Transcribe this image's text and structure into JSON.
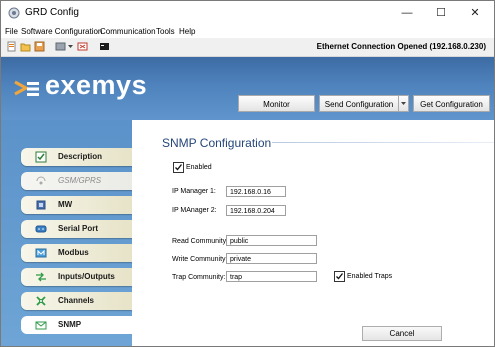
{
  "window": {
    "title": "GRD Config",
    "minimize_glyph": "—",
    "maximize_glyph": "☐",
    "close_glyph": "✕"
  },
  "menubar": {
    "items": [
      "File",
      "Software Configuration",
      "Communication",
      "Tools",
      "Help"
    ]
  },
  "toolbar": {
    "icons": [
      "new-file-icon",
      "open-folder-icon",
      "save-icon",
      "connect-icon",
      "dropdown-icon",
      "disconnect-icon",
      "terminal-icon"
    ],
    "connection_status": "Ethernet Connection Opened (192.168.0.230)"
  },
  "header": {
    "logo_text": "exemys",
    "buttons": {
      "monitor": "Monitor",
      "send": "Send Configuration",
      "get": "Get Configuration"
    }
  },
  "sidebar": {
    "items": [
      {
        "label": "Description",
        "icon": "description-icon"
      },
      {
        "label": "GSM/GPRS",
        "icon": "gsm-icon",
        "disabled": true
      },
      {
        "label": "MW",
        "icon": "mw-icon"
      },
      {
        "label": "Serial Port",
        "icon": "serial-port-icon"
      },
      {
        "label": "Modbus",
        "icon": "modbus-icon"
      },
      {
        "label": "Inputs/Outputs",
        "icon": "io-icon"
      },
      {
        "label": "Channels",
        "icon": "channels-icon"
      },
      {
        "label": "SNMP",
        "icon": "snmp-icon",
        "active": true
      }
    ]
  },
  "snmp": {
    "title": "SNMP Configuration",
    "enabled_label": "Enabled",
    "enabled": true,
    "ip_manager_1_label": "IP Manager 1:",
    "ip_manager_1": "192.168.0.16",
    "ip_manager_2_label": "IP MAnager 2:",
    "ip_manager_2": "192.168.0.204",
    "read_community_label": "Read Community:",
    "read_community": "public",
    "write_community_label": "Write Community:",
    "write_community": "private",
    "trap_community_label": "Trap Community:",
    "trap_community": "trap",
    "enabled_traps_label": "Enabled Traps",
    "enabled_traps": true,
    "cancel_label": "Cancel"
  }
}
